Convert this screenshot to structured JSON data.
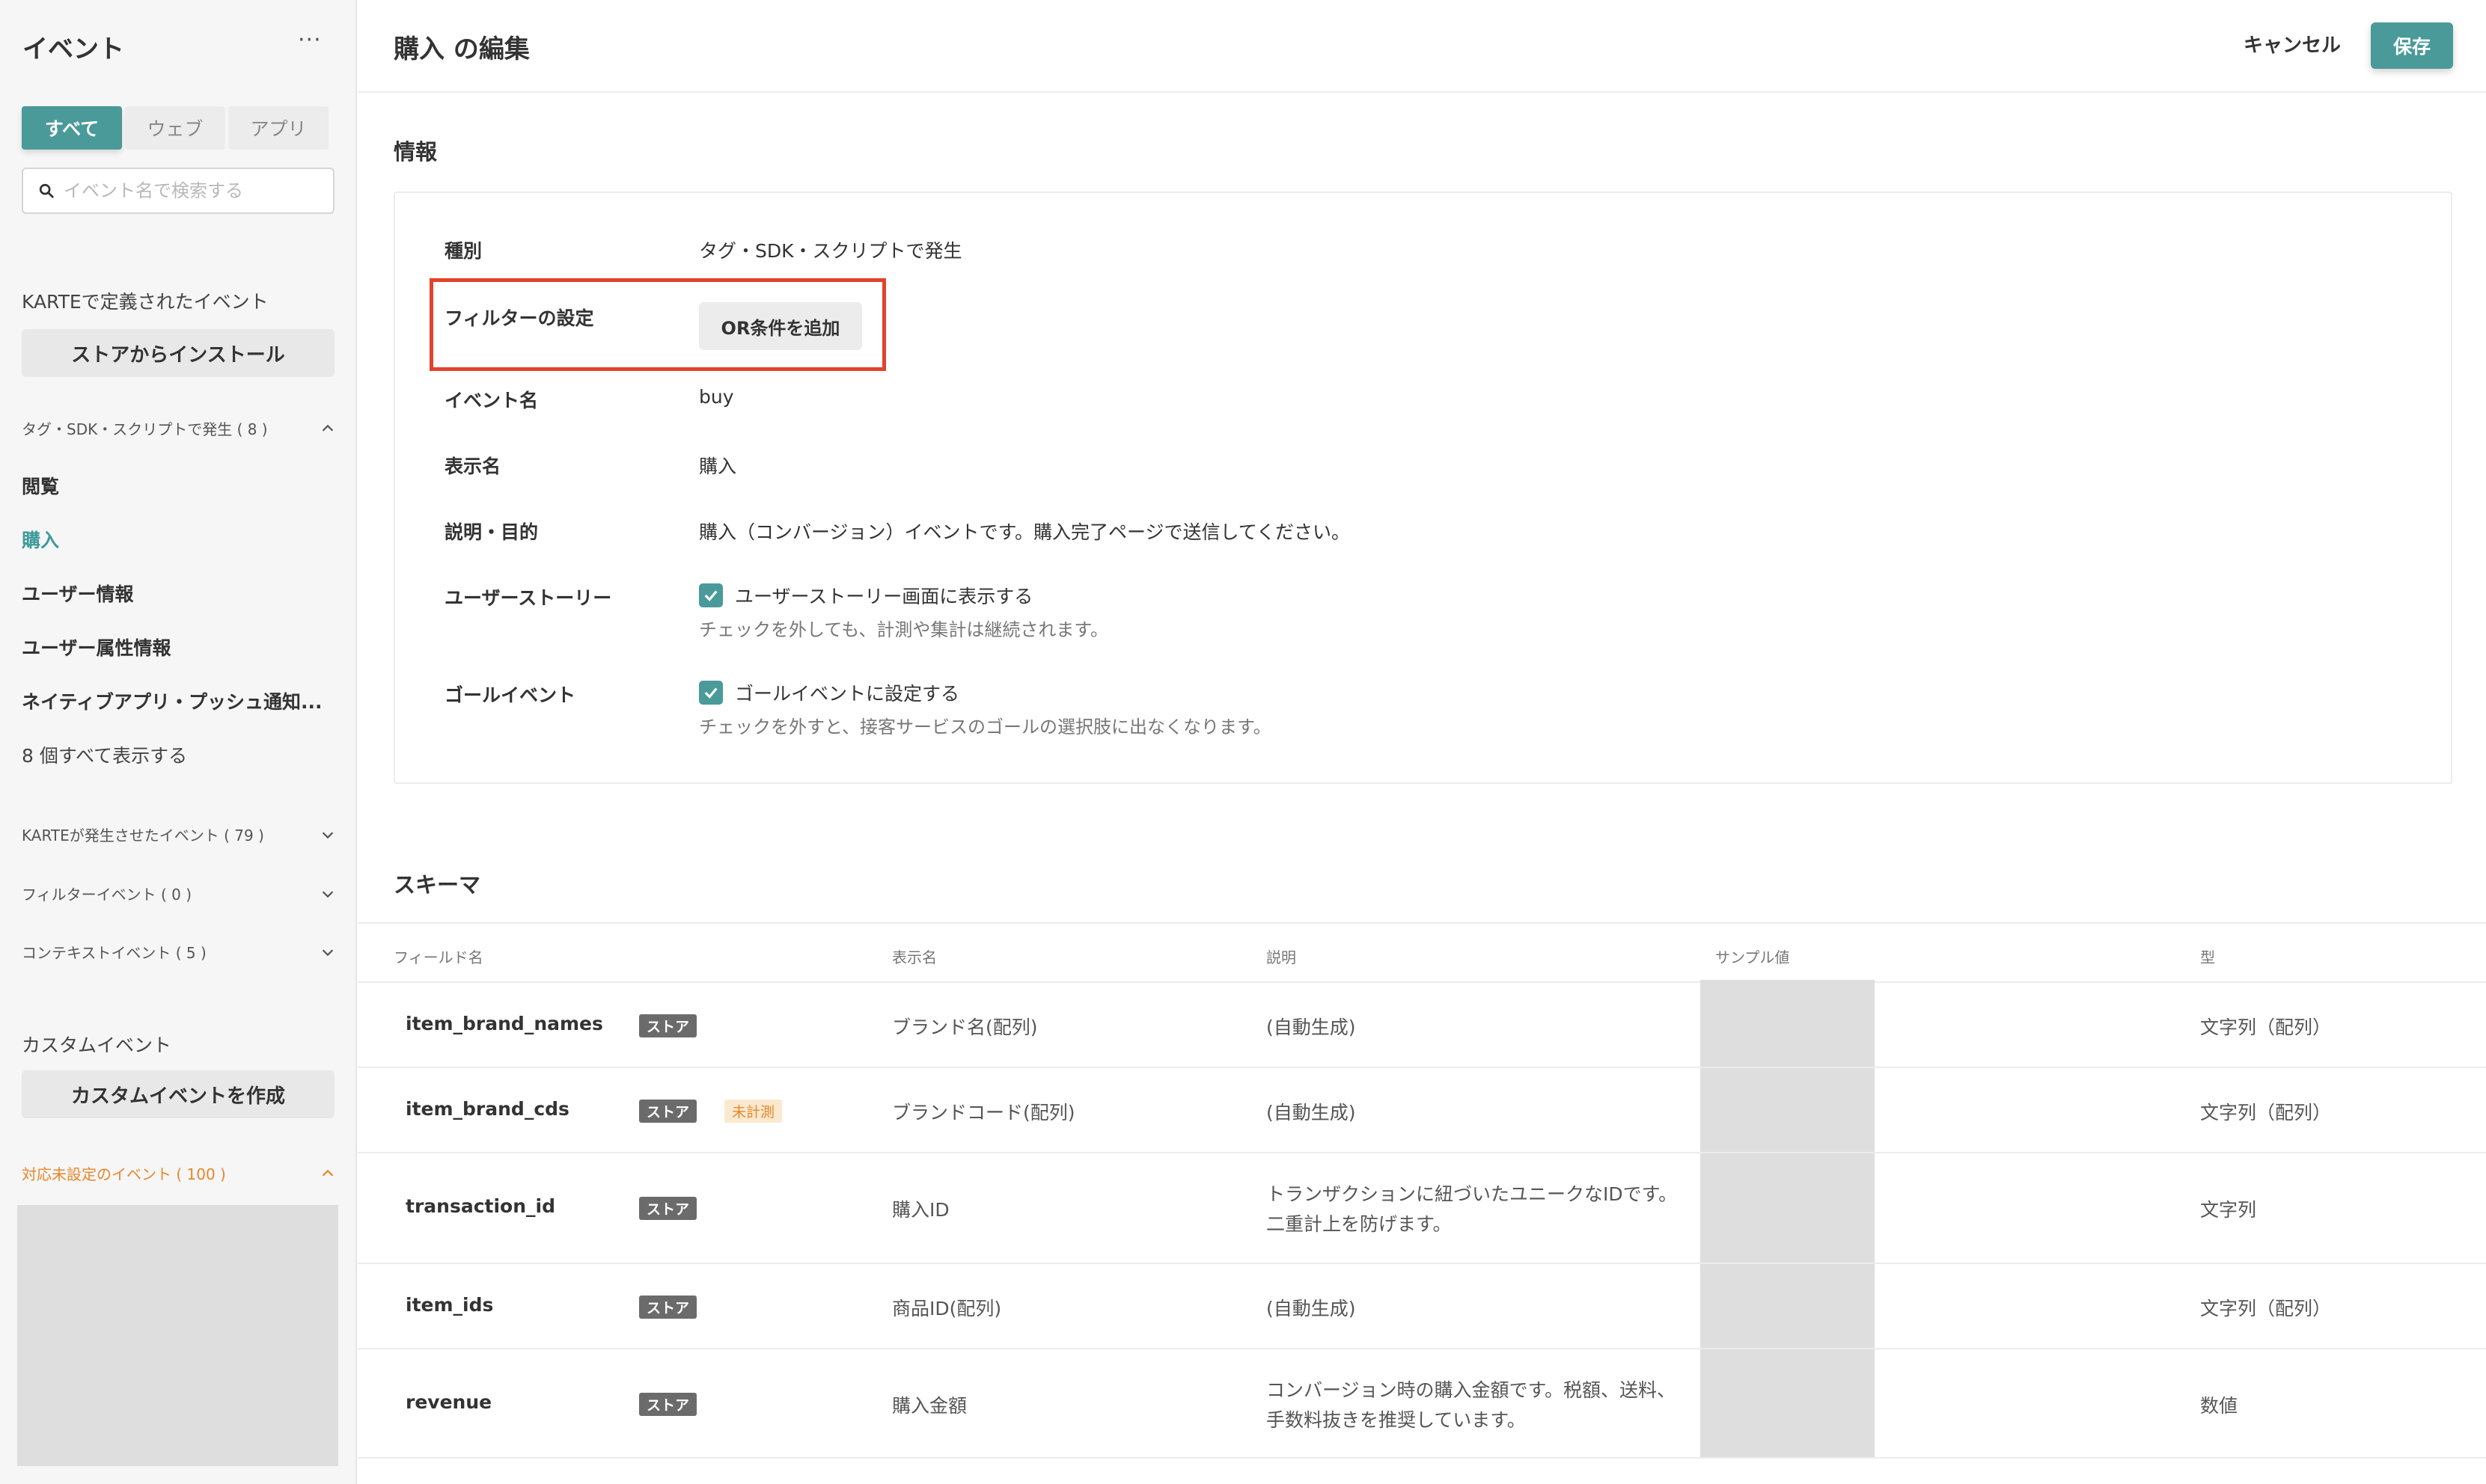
{
  "sidebar": {
    "title": "イベント",
    "more": "···",
    "tabs": [
      {
        "label": "すべて"
      },
      {
        "label": "ウェブ"
      },
      {
        "label": "アプリ"
      }
    ],
    "search_placeholder": "イベント名で検索する",
    "karte_section_title": "KARTEで定義されたイベント",
    "install_button": "ストアからインストール",
    "group_tag_sdk": "タグ・SDK・スクリプトで発生 ( 8 )",
    "items": [
      {
        "label": "閲覧"
      },
      {
        "label": "購入"
      },
      {
        "label": "ユーザー情報"
      },
      {
        "label": "ユーザー属性情報"
      },
      {
        "label": "ネイティブアプリ・プッシュ通知..."
      }
    ],
    "show_all": "8 個すべて表示する",
    "group_karte_generated": "KARTEが発生させたイベント ( 79 )",
    "group_filter": "フィルターイベント ( 0 )",
    "group_context": "コンテキストイベント ( 5 )",
    "custom_section_title": "カスタムイベント",
    "create_custom_button": "カスタムイベントを作成",
    "group_unconfigured": "対応未設定のイベント ( 100 )"
  },
  "header": {
    "title": "購入 の編集",
    "cancel": "キャンセル",
    "save": "保存"
  },
  "info": {
    "section_title": "情報",
    "type_label": "種別",
    "type_value": "タグ・SDK・スクリプトで発生",
    "filter_label": "フィルターの設定",
    "or_button": "OR条件を追加",
    "event_name_label": "イベント名",
    "event_name_value": "buy",
    "display_name_label": "表示名",
    "display_name_value": "購入",
    "description_label": "説明・目的",
    "description_value": "購入（コンバージョン）イベントです。購入完了ページで送信してください。",
    "userstory_label": "ユーザーストーリー",
    "userstory_check": "ユーザーストーリー画面に表示する",
    "userstory_note": "チェックを外しても、計測や集計は継続されます。",
    "goal_label": "ゴールイベント",
    "goal_check": "ゴールイベントに設定する",
    "goal_note": "チェックを外すと、接客サービスのゴールの選択肢に出なくなります。"
  },
  "schema": {
    "section_title": "スキーマ",
    "columns": {
      "field": "フィールド名",
      "display": "表示名",
      "description": "説明",
      "sample": "サンプル値",
      "type": "型"
    },
    "badge_store": "ストア",
    "badge_unmeasured": "未計測",
    "rows": [
      {
        "field": "item_brand_names",
        "display": "ブランド名(配列)",
        "desc1": "(自動生成)",
        "desc2": "",
        "type": "文字列（配列）"
      },
      {
        "field": "item_brand_cds",
        "display": "ブランドコード(配列)",
        "desc1": "(自動生成)",
        "desc2": "",
        "type": "文字列（配列）"
      },
      {
        "field": "transaction_id",
        "display": "購入ID",
        "desc1": "トランザクションに紐づいたユニークなIDです。",
        "desc2": "二重計上を防げます。",
        "type": "文字列"
      },
      {
        "field": "item_ids",
        "display": "商品ID(配列)",
        "desc1": "(自動生成)",
        "desc2": "",
        "type": "文字列（配列）"
      },
      {
        "field": "revenue",
        "display": "購入金額",
        "desc1": "コンバージョン時の購入金額です。税額、送料、",
        "desc2": "手数料抜きを推奨しています。",
        "type": "数値"
      }
    ]
  },
  "colors": {
    "accent": "#4a9a9a",
    "highlight": "#e2422c",
    "warning": "#e8862a"
  }
}
